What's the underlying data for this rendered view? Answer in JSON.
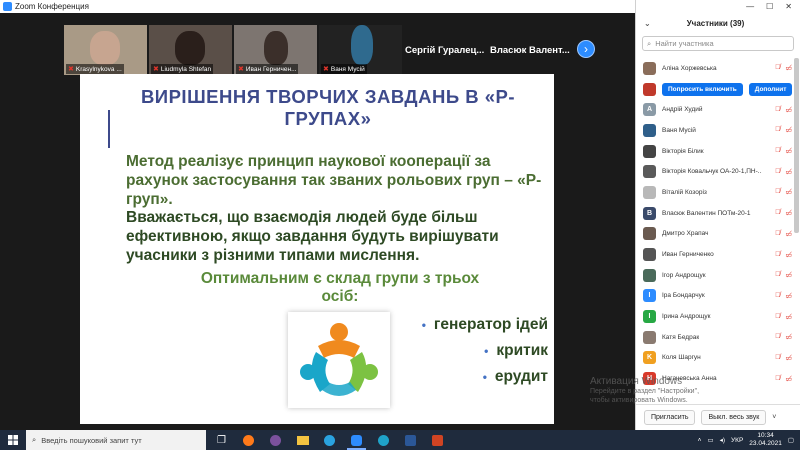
{
  "window": {
    "title": "Zoom Конференция"
  },
  "thumbnails": [
    {
      "name": "Krasylnykova ..."
    },
    {
      "name": "Liudmyla Shtefan"
    },
    {
      "name": "Иван Герничен..."
    },
    {
      "name": "Ваня Мусій"
    }
  ],
  "name_tiles": [
    {
      "name": "Сергій Гуралец..."
    },
    {
      "name": "Власюк Валент..."
    }
  ],
  "slide": {
    "title": "ВИРІШЕННЯ ТВОРЧИХ ЗАВДАНЬ В «Р-ГРУПАХ»",
    "para1": "Метод реалізує принцип наукової кооперації за рахунок застосування так званих рольових груп – «Р-груп».",
    "para2": "Вважається, що взаємодія людей буде більш ефективною, якщо завдання будуть вирішувати учасники з різними типами мислення.",
    "para3": "Оптимальним є склад групи з трьох  осіб:",
    "bullets": [
      "генератор ідей",
      "критик",
      "ерудит"
    ]
  },
  "panel": {
    "title": "Участники (39)",
    "search_placeholder": "Найти участника",
    "participants": [
      {
        "name": "Аліна Хоржевська",
        "avatar_color": "#8a6d5a",
        "initial": ""
      },
      {
        "name": "",
        "avatar_color": "#c0392b",
        "initial": "",
        "buttons": [
          "Попросить включить",
          "Дополнит"
        ]
      },
      {
        "name": "Андрій Худий",
        "avatar_color": "#8a9aa6",
        "initial": "A"
      },
      {
        "name": "Ваня Мусій",
        "avatar_color": "#2f5f8a",
        "initial": ""
      },
      {
        "name": "Вікторія Білик",
        "avatar_color": "#444",
        "initial": ""
      },
      {
        "name": "Вікторія Ковальчук ОА-20-1,ПН-...",
        "avatar_color": "#5a5a5a",
        "initial": ""
      },
      {
        "name": "Віталій Козоріз",
        "avatar_color": "#b8b8b8",
        "initial": ""
      },
      {
        "name": "Власюк Валентин ПОТм-20-1",
        "avatar_color": "#3a4a6a",
        "initial": "B"
      },
      {
        "name": "Дмитро Храпач",
        "avatar_color": "#6a5a50",
        "initial": ""
      },
      {
        "name": "Иван Герниченко",
        "avatar_color": "#555",
        "initial": ""
      },
      {
        "name": "Ігор Андрощук",
        "avatar_color": "#4a6a5a",
        "initial": ""
      },
      {
        "name": "Іра Бондарчук",
        "avatar_color": "#2d8cff",
        "initial": "I"
      },
      {
        "name": "Ірина  Андрощук",
        "avatar_color": "#27a844",
        "initial": "I"
      },
      {
        "name": "Катя Бедрак",
        "avatar_color": "#8a7a70",
        "initial": ""
      },
      {
        "name": "Коля Шаргун",
        "avatar_color": "#f0a020",
        "initial": "K"
      },
      {
        "name": "Нагачевська Анна",
        "avatar_color": "#d93a2b",
        "initial": "H"
      }
    ],
    "footer": {
      "invite_label": "Пригласить",
      "mute_all_label": "Выкл. весь звук"
    }
  },
  "activation": {
    "title": "Активация Windows",
    "subtitle": "Перейдите в раздел \"Настройки\", чтобы активировать Windows."
  },
  "taskbar": {
    "search_placeholder": "Введіть пошуковий запит тут",
    "lang": "УКР",
    "time": "10:34",
    "date": "23.04.2021"
  }
}
